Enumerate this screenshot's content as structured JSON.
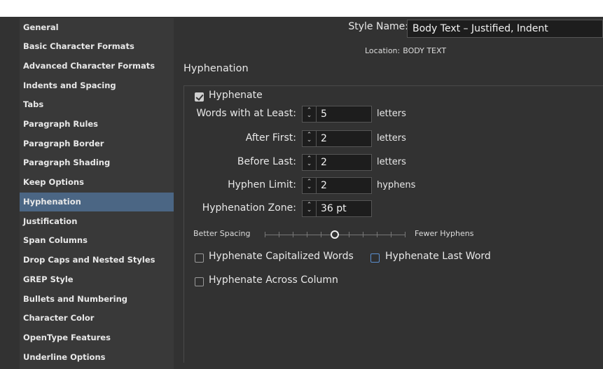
{
  "sidebar": {
    "items": [
      {
        "label": "General"
      },
      {
        "label": "Basic Character Formats"
      },
      {
        "label": "Advanced Character Formats"
      },
      {
        "label": "Indents and Spacing"
      },
      {
        "label": "Tabs"
      },
      {
        "label": "Paragraph Rules"
      },
      {
        "label": "Paragraph Border"
      },
      {
        "label": "Paragraph Shading"
      },
      {
        "label": "Keep Options"
      },
      {
        "label": "Hyphenation",
        "selected": true
      },
      {
        "label": "Justification"
      },
      {
        "label": "Span Columns"
      },
      {
        "label": "Drop Caps and Nested Styles"
      },
      {
        "label": "GREP Style"
      },
      {
        "label": "Bullets and Numbering"
      },
      {
        "label": "Character Color"
      },
      {
        "label": "OpenType Features"
      },
      {
        "label": "Underline Options"
      }
    ]
  },
  "header": {
    "style_name_label": "Style Name:",
    "style_name_value": "Body Text – Justified, Indent",
    "location_label": "Location:",
    "location_value": "BODY TEXT"
  },
  "section": {
    "title": "Hyphenation",
    "hyphenate": {
      "label": "Hyphenate",
      "checked": true
    },
    "fields": [
      {
        "label": "Words with at Least:",
        "value": "5",
        "unit": "letters"
      },
      {
        "label": "After First:",
        "value": "2",
        "unit": "letters"
      },
      {
        "label": "Before Last:",
        "value": "2",
        "unit": "letters"
      },
      {
        "label": "Hyphen Limit:",
        "value": "2",
        "unit": "hyphens"
      },
      {
        "label": "Hyphenation Zone:",
        "value": "36 pt",
        "unit": ""
      }
    ],
    "slider": {
      "left_label": "Better Spacing",
      "right_label": "Fewer Hyphens",
      "position_fraction": 0.5
    },
    "options": [
      {
        "label": "Hyphenate Capitalized Words",
        "checked": false
      },
      {
        "label": "Hyphenate Last Word",
        "checked": false
      },
      {
        "label": "Hyphenate Across Column",
        "checked": false
      }
    ]
  },
  "colors": {
    "background": "#323232",
    "sidebar": "#393939",
    "selected": "#4b6684",
    "field": "#1d1d1d"
  }
}
